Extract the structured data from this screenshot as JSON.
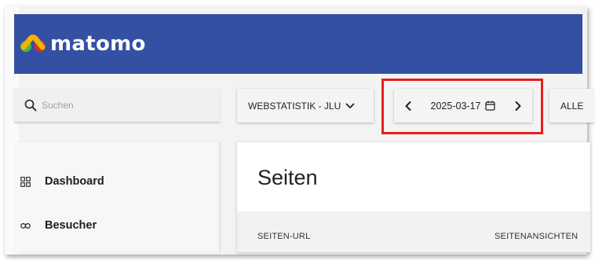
{
  "app": {
    "name": "matomo",
    "brand_color": "#3450a3",
    "logo_colors": [
      "#f8b100",
      "#3ebd4f",
      "#d92e2e"
    ]
  },
  "toolbar": {
    "search": {
      "placeholder": "Suchen",
      "value": "",
      "icon": "search-icon"
    },
    "site_selector": {
      "label": "WEBSTATISTIK - JLU",
      "icon": "chevron-down-icon"
    },
    "date": {
      "value": "2025-03-17",
      "prev_icon": "chevron-left-icon",
      "next_icon": "chevron-right-icon",
      "calendar_icon": "calendar-icon",
      "highlight_color": "#e81e1e"
    },
    "segment": {
      "label": "ALLE"
    }
  },
  "menu": {
    "items": [
      {
        "label": "Dashboard",
        "icon": "dashboard-grid-icon"
      },
      {
        "label": "Besucher",
        "icon": "visitors-icon"
      }
    ]
  },
  "content": {
    "title": "Seiten",
    "columns": [
      "SEITEN-URL",
      "SEITENANSICHTEN"
    ]
  }
}
